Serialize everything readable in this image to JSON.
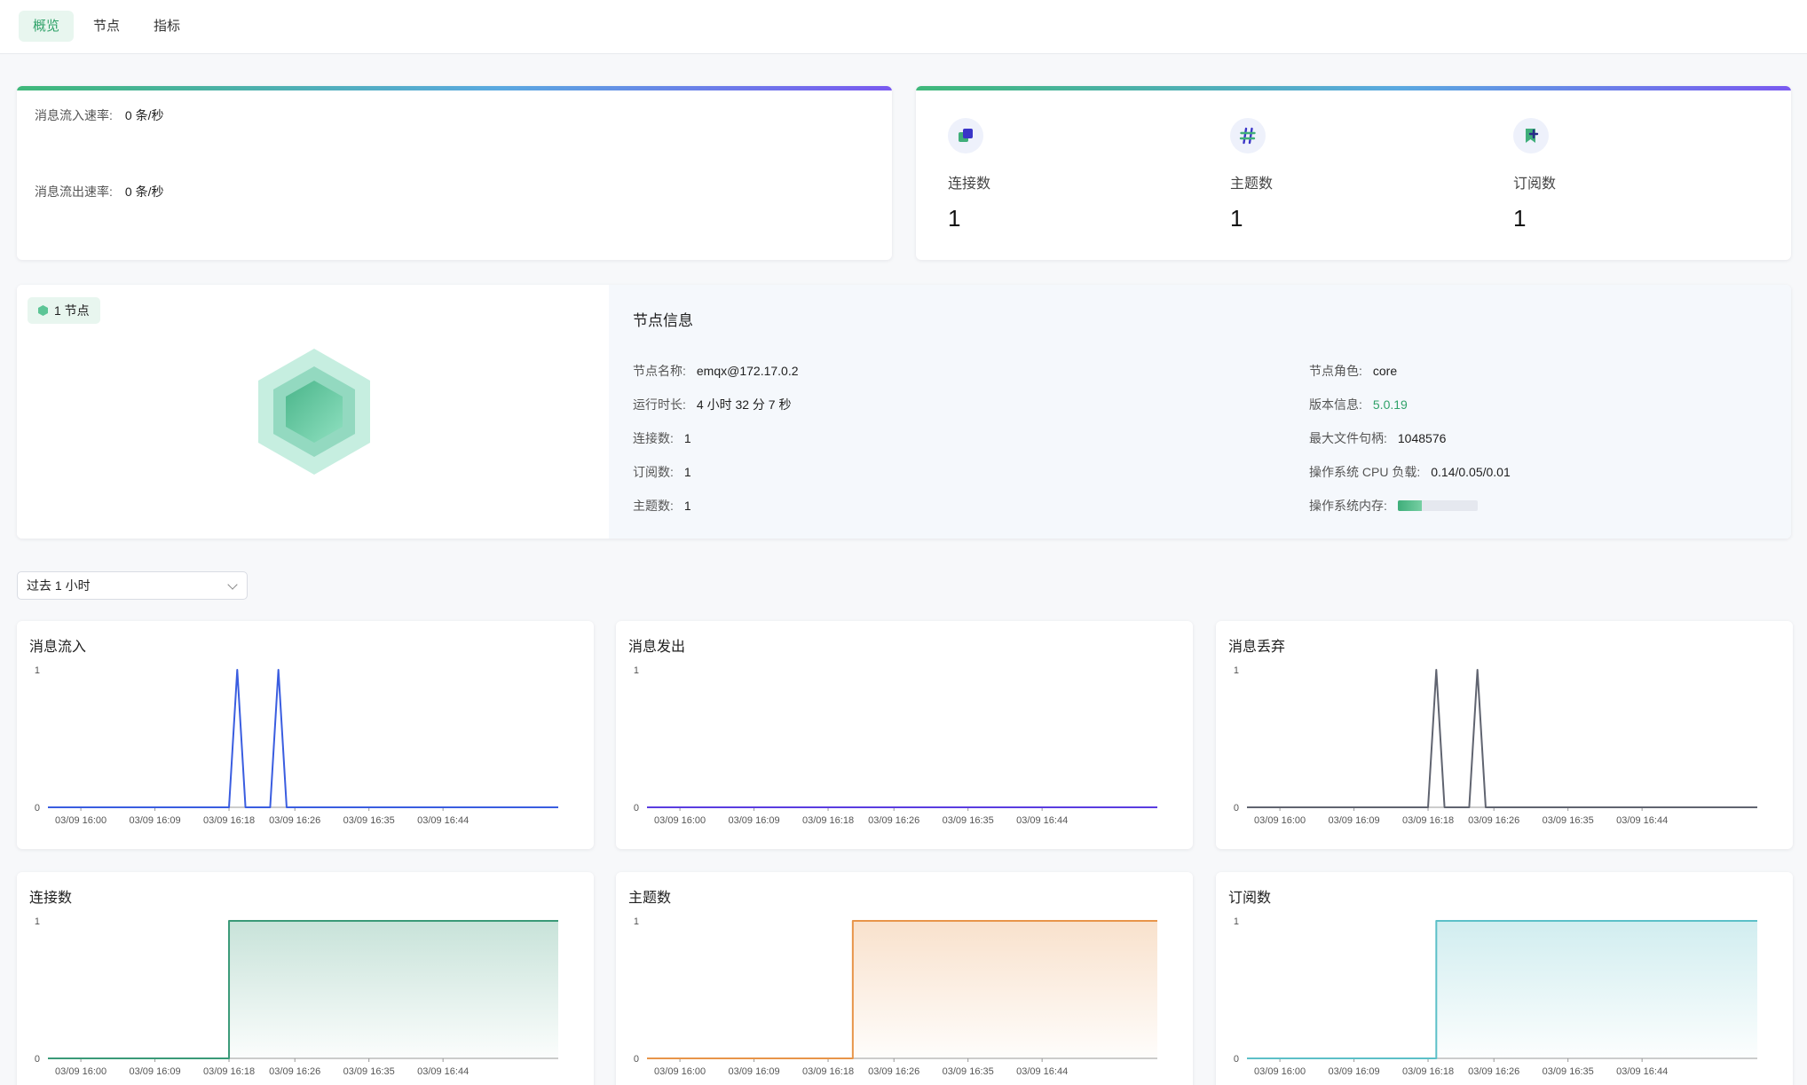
{
  "tabs": [
    {
      "label": "概览",
      "active": true
    },
    {
      "label": "节点",
      "active": false
    },
    {
      "label": "指标",
      "active": false
    }
  ],
  "rates": {
    "in_label": "消息流入速率:",
    "in_value": "0 条/秒",
    "out_label": "消息流出速率:",
    "out_value": "0 条/秒"
  },
  "stats": [
    {
      "icon": "connections-icon",
      "label": "连接数",
      "value": "1"
    },
    {
      "icon": "hash-topic-icon",
      "label": "主题数",
      "value": "1"
    },
    {
      "icon": "subscription-icon",
      "label": "订阅数",
      "value": "1"
    }
  ],
  "node": {
    "badge": "1 节点",
    "title": "节点信息",
    "left_rows": [
      {
        "label": "节点名称:",
        "value": "emqx@172.17.0.2"
      },
      {
        "label": "运行时长:",
        "value": "4 小时 32 分 7 秒"
      },
      {
        "label": "连接数:",
        "value": "1"
      },
      {
        "label": "订阅数:",
        "value": "1"
      },
      {
        "label": "主题数:",
        "value": "1"
      }
    ],
    "right_rows": [
      {
        "label": "节点角色:",
        "value": "core"
      },
      {
        "label": "版本信息:",
        "value": "5.0.19"
      },
      {
        "label": "最大文件句柄:",
        "value": "1048576"
      },
      {
        "label": "操作系统 CPU 负载:",
        "value": "0.14/0.05/0.01"
      },
      {
        "label": "操作系统内存:"
      }
    ],
    "memory_fraction": 0.3
  },
  "time_range": {
    "value": "过去 1 小时"
  },
  "colors": {
    "accent": "#31a26a"
  },
  "chart_data": [
    {
      "type": "line",
      "title": "消息流入",
      "color": "#3a5de0",
      "fill": false,
      "ylim": [
        0,
        1
      ],
      "yticks": [
        "0",
        "1"
      ],
      "xticks": [
        "03/09 16:00",
        "03/09 16:09",
        "03/09 16:18",
        "03/09 16:26",
        "03/09 16:35",
        "03/09 16:44"
      ],
      "x": [
        "03/09 15:56",
        "03/09 16:18",
        "03/09 16:19",
        "03/09 16:20",
        "03/09 16:23",
        "03/09 16:24",
        "03/09 16:25",
        "03/09 16:58"
      ],
      "series": [
        {
          "values": [
            0,
            0,
            1,
            0,
            0,
            1,
            0,
            0
          ]
        }
      ]
    },
    {
      "type": "line",
      "title": "消息发出",
      "color": "#5a3de0",
      "fill": false,
      "ylim": [
        0,
        1
      ],
      "yticks": [
        "0",
        "1"
      ],
      "xticks": [
        "03/09 16:00",
        "03/09 16:09",
        "03/09 16:18",
        "03/09 16:26",
        "03/09 16:35",
        "03/09 16:44"
      ],
      "x": [
        "03/09 15:56",
        "03/09 16:58"
      ],
      "series": [
        {
          "values": [
            0,
            0
          ]
        }
      ]
    },
    {
      "type": "line",
      "title": "消息丢弃",
      "color": "#606470",
      "fill": false,
      "ylim": [
        0,
        1
      ],
      "yticks": [
        "0",
        "1"
      ],
      "xticks": [
        "03/09 16:00",
        "03/09 16:09",
        "03/09 16:18",
        "03/09 16:26",
        "03/09 16:35",
        "03/09 16:44"
      ],
      "x": [
        "03/09 15:56",
        "03/09 16:18",
        "03/09 16:19",
        "03/09 16:20",
        "03/09 16:23",
        "03/09 16:24",
        "03/09 16:25",
        "03/09 16:58"
      ],
      "series": [
        {
          "values": [
            0,
            0,
            1,
            0,
            0,
            1,
            0,
            0
          ]
        }
      ]
    },
    {
      "type": "area",
      "title": "连接数",
      "color": "#3a9a78",
      "fill": true,
      "ylim": [
        0,
        1
      ],
      "yticks": [
        "0",
        "1"
      ],
      "xticks": [
        "03/09 16:00",
        "03/09 16:09",
        "03/09 16:18",
        "03/09 16:26",
        "03/09 16:35",
        "03/09 16:44"
      ],
      "x": [
        "03/09 15:56",
        "03/09 16:18",
        "03/09 16:18",
        "03/09 16:58"
      ],
      "series": [
        {
          "values": [
            0,
            0,
            1,
            1
          ]
        }
      ]
    },
    {
      "type": "area",
      "title": "主题数",
      "color": "#e8954a",
      "fill": true,
      "ylim": [
        0,
        1
      ],
      "yticks": [
        "0",
        "1"
      ],
      "xticks": [
        "03/09 16:00",
        "03/09 16:09",
        "03/09 16:18",
        "03/09 16:26",
        "03/09 16:35",
        "03/09 16:44"
      ],
      "x": [
        "03/09 15:56",
        "03/09 16:21",
        "03/09 16:21",
        "03/09 16:58"
      ],
      "series": [
        {
          "values": [
            0,
            0,
            1,
            1
          ]
        }
      ]
    },
    {
      "type": "area",
      "title": "订阅数",
      "color": "#5cc0c8",
      "fill": true,
      "ylim": [
        0,
        1
      ],
      "yticks": [
        "0",
        "1"
      ],
      "xticks": [
        "03/09 16:00",
        "03/09 16:09",
        "03/09 16:18",
        "03/09 16:26",
        "03/09 16:35",
        "03/09 16:44"
      ],
      "x": [
        "03/09 15:56",
        "03/09 16:19",
        "03/09 16:19",
        "03/09 16:58"
      ],
      "series": [
        {
          "values": [
            0,
            0,
            1,
            1
          ]
        }
      ]
    }
  ]
}
